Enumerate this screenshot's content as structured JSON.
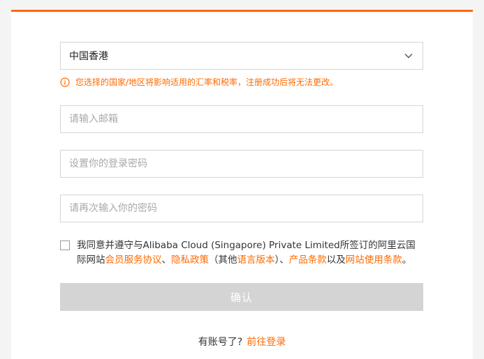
{
  "form": {
    "region_select": {
      "value": "中国香港"
    },
    "region_notice": "您选择的国家/地区将影响适用的汇率和税率，注册成功后将无法更改。",
    "email": {
      "placeholder": "请输入邮箱",
      "value": ""
    },
    "password": {
      "placeholder": "设置你的登录密码",
      "value": ""
    },
    "password_confirm": {
      "placeholder": "请再次输入你的密码",
      "value": ""
    },
    "agreement": {
      "checked": false,
      "text_1": "我同意并遵守与Alibaba Cloud (Singapore) Private Limited所签订的阿里云国际网站",
      "link_member": "会员服务协议",
      "sep_1": "、",
      "link_privacy": "隐私政策",
      "text_2": "（其他",
      "link_language": "语言版本",
      "text_3": "）、",
      "link_product": "产品条款",
      "text_4": "以及",
      "link_site_terms": "网站使用条款",
      "text_5": "。"
    },
    "confirm_label": "确认",
    "login_prompt": "有账号了?",
    "login_link": "前往登录"
  },
  "colors": {
    "accent": "#ff6a00",
    "disabled_button": "#d4d4d4"
  },
  "icons": {
    "chevron": "chevron-down-icon",
    "info": "info-icon"
  }
}
